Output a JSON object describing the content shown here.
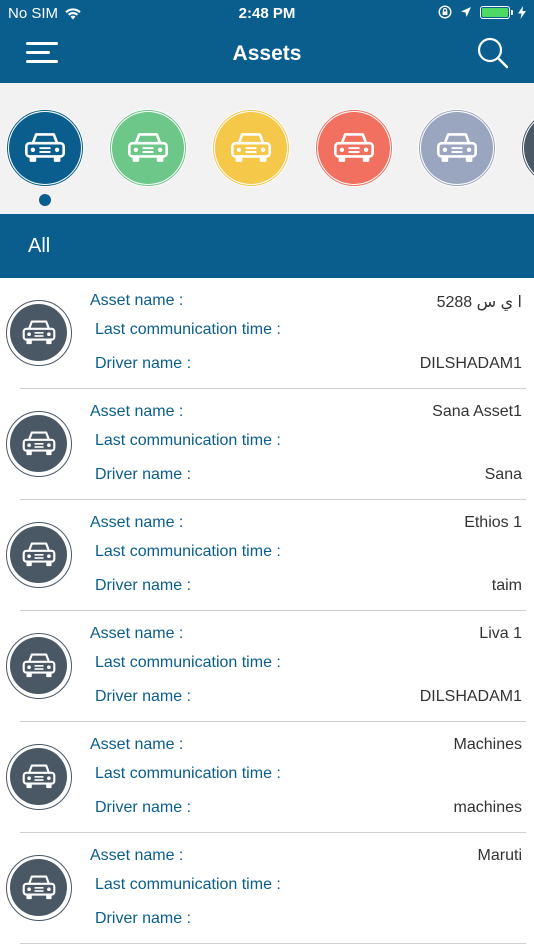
{
  "status": {
    "carrier": "No SIM",
    "time": "2:48 PM"
  },
  "nav": {
    "title": "Assets"
  },
  "filters": [
    {
      "name": "all",
      "color": "#0a5e8e",
      "active": true
    },
    {
      "name": "green",
      "color": "#6cc788",
      "active": false
    },
    {
      "name": "yellow",
      "color": "#f5c84a",
      "active": false
    },
    {
      "name": "red",
      "color": "#f2705f",
      "active": false
    },
    {
      "name": "gray",
      "color": "#9aa5c0",
      "active": false
    },
    {
      "name": "dark",
      "color": "#4a5866",
      "active": false
    }
  ],
  "section": {
    "title": "All"
  },
  "labels": {
    "asset_name": "Asset name :",
    "last_comm": "Last communication time :",
    "driver_name": "Driver name :"
  },
  "assets": [
    {
      "asset_name": "ا ي س 5288",
      "last_comm": "",
      "driver": "DILSHADAM1"
    },
    {
      "asset_name": "Sana Asset1",
      "last_comm": "",
      "driver": "Sana"
    },
    {
      "asset_name": "Ethios 1",
      "last_comm": "",
      "driver": "taim"
    },
    {
      "asset_name": "Liva 1",
      "last_comm": "",
      "driver": "DILSHADAM1"
    },
    {
      "asset_name": "Machines",
      "last_comm": "",
      "driver": "machines"
    },
    {
      "asset_name": "Maruti",
      "last_comm": "",
      "driver": ""
    }
  ],
  "colors": {
    "primary": "#0a5e8e",
    "avatar": "#4a5866"
  }
}
